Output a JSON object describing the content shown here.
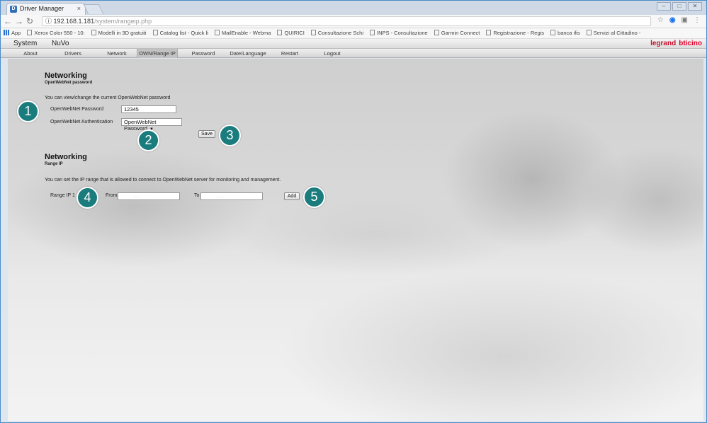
{
  "browser": {
    "tab_title": "Driver Manager",
    "tab_close": "×",
    "favicon_letter": "D",
    "url_host": "192.168.1.181",
    "url_path": "/system/rangeip.php",
    "window_controls": [
      "–",
      "□",
      "✕"
    ]
  },
  "bookmarks": [
    {
      "label": "App",
      "icon": "apps-grid-icon"
    },
    {
      "label": "Xerox Color 550 - 10:",
      "icon": "page-icon"
    },
    {
      "label": "Modelli in 3D gratuiti",
      "icon": "page-icon"
    },
    {
      "label": "Catalog list - Quick li",
      "icon": "page-icon"
    },
    {
      "label": "MailEnable - Webma",
      "icon": "page-icon"
    },
    {
      "label": "QUIRICI",
      "icon": "page-icon"
    },
    {
      "label": "Consultazione Schi",
      "icon": "page-icon"
    },
    {
      "label": "INPS - Consultazione",
      "icon": "page-icon"
    },
    {
      "label": "Garmin Connect",
      "icon": "page-icon"
    },
    {
      "label": "Registrazione - Regis",
      "icon": "page-icon"
    },
    {
      "label": "banca ifis",
      "icon": "page-icon"
    },
    {
      "label": "Servizi al Cittadino -",
      "icon": "page-icon"
    }
  ],
  "app": {
    "top_tabs": [
      "System",
      "NuVo"
    ],
    "brand_legrand": "legrand",
    "brand_bticino": "bticino",
    "menu": [
      "About",
      "Drivers",
      "Network",
      "OWN/Range IP",
      "Password",
      "Date/Language",
      "Restart",
      "Logout"
    ],
    "active_menu": "OWN/Range IP"
  },
  "password_section": {
    "title": "Networking",
    "subtitle": "OpenWebNet password",
    "description": "You can view/change the current OpenWebNet password",
    "password_label": "OpenWebNet Password",
    "password_value": "12345",
    "auth_label": "OpenWebNet Authentication",
    "auth_selected": "OpenWebNet Password",
    "save_label": "Save"
  },
  "range_section": {
    "title": "Networking",
    "subtitle": "Range IP",
    "description": "You can set the IP range that is allowed to connect to OpenWebNet server for monitoring and management.",
    "range_label": "Range IP 1",
    "from_label": "From",
    "to_label": "To",
    "add_label": "Add",
    "ip_dots": ".     .     ."
  },
  "markers": [
    "1",
    "2",
    "3",
    "4",
    "5"
  ],
  "colors": {
    "marker": "#1b7c7e",
    "window_frame": "#4a8bc9",
    "brand_red": "#e4002b"
  }
}
